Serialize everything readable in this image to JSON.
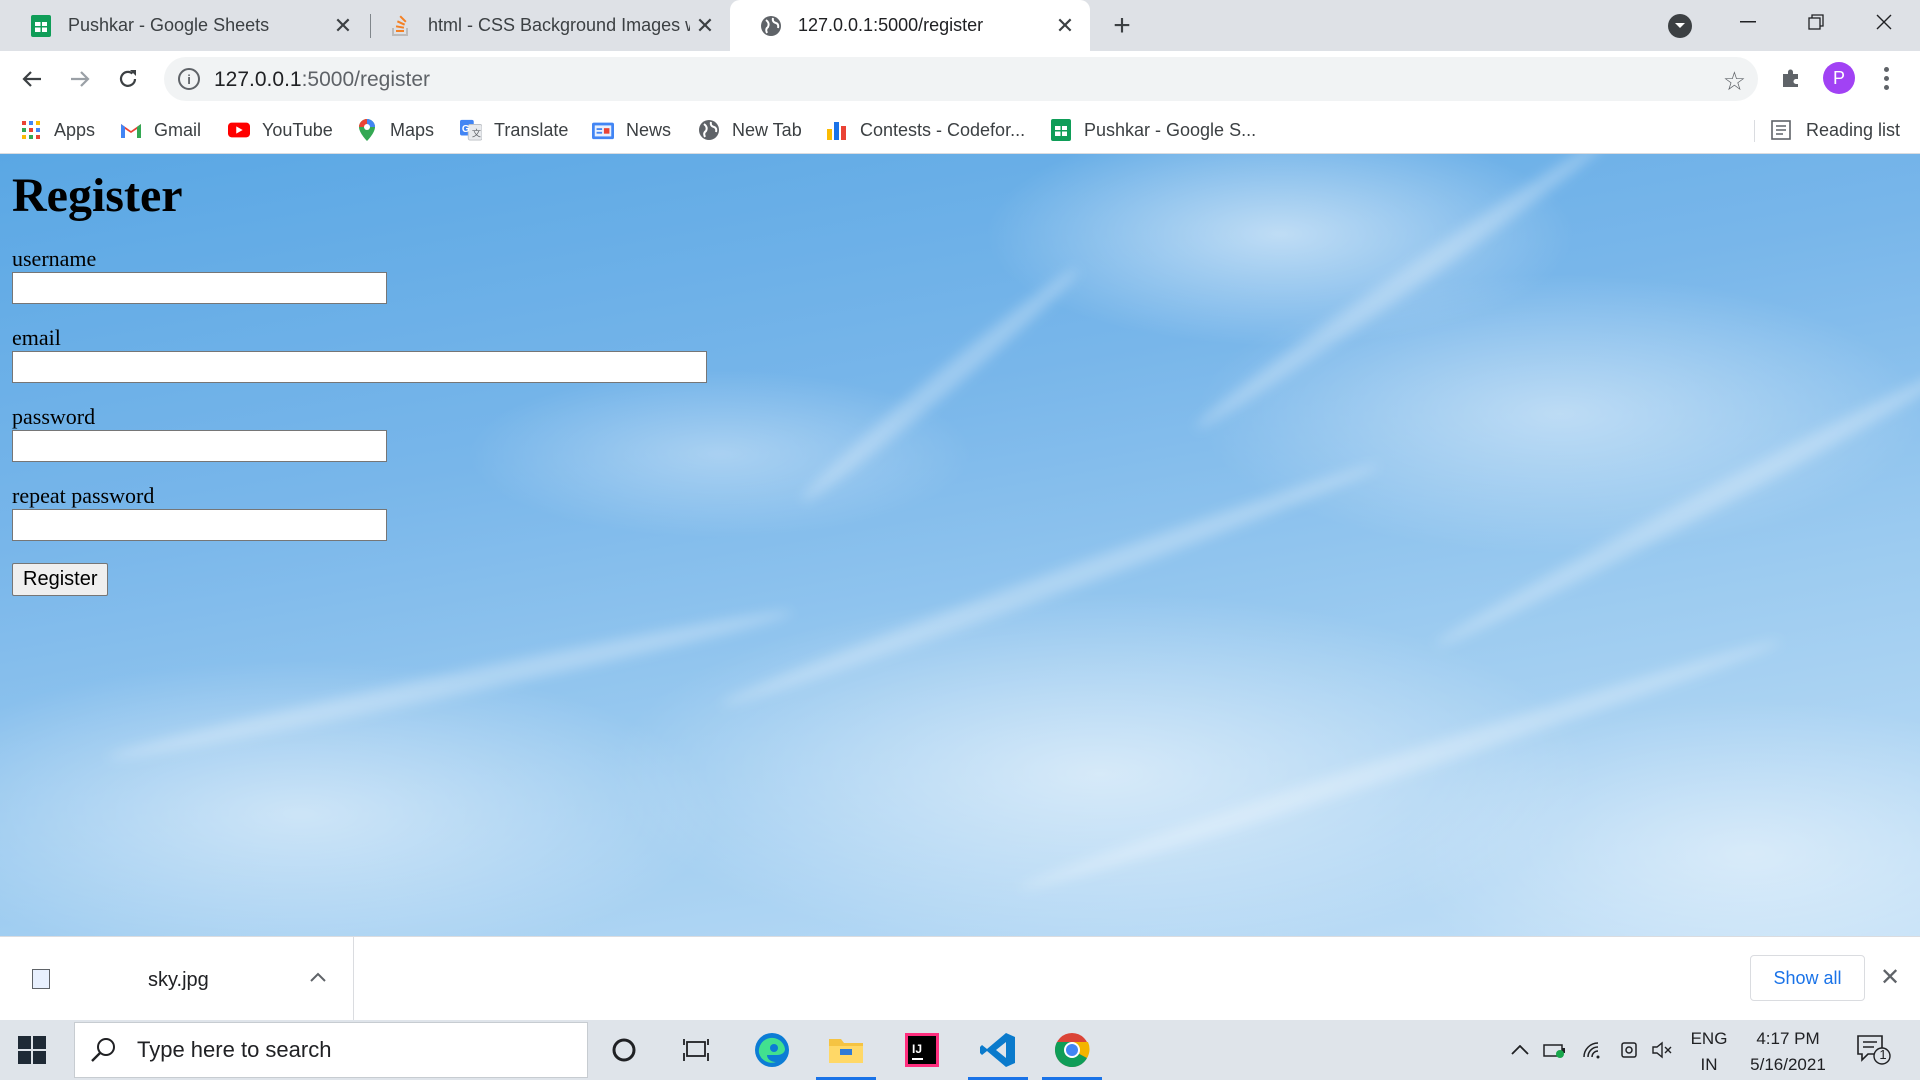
{
  "browser": {
    "tabs": [
      {
        "title": "Pushkar - Google Sheets",
        "icon": "google-sheets-icon",
        "active": false
      },
      {
        "title": "html - CSS Background Images w",
        "icon": "stackoverflow-icon",
        "active": false
      },
      {
        "title": "127.0.0.1:5000/register",
        "icon": "globe-icon",
        "active": true
      }
    ],
    "address": {
      "host": "127.0.0.1",
      "rest": ":5000/register"
    },
    "profile_initial": "P",
    "bookmarks": [
      {
        "label": "Apps",
        "icon": "apps-grid-icon"
      },
      {
        "label": "Gmail",
        "icon": "gmail-icon"
      },
      {
        "label": "YouTube",
        "icon": "youtube-icon"
      },
      {
        "label": "Maps",
        "icon": "maps-pin-icon"
      },
      {
        "label": "Translate",
        "icon": "translate-icon"
      },
      {
        "label": "News",
        "icon": "news-icon"
      },
      {
        "label": "New Tab",
        "icon": "globe-icon"
      },
      {
        "label": "Contests - Codefor...",
        "icon": "codeforces-icon"
      },
      {
        "label": "Pushkar - Google S...",
        "icon": "google-sheets-icon"
      }
    ],
    "reading_list": "Reading list"
  },
  "page": {
    "heading": "Register",
    "fields": [
      {
        "label": "username",
        "value": ""
      },
      {
        "label": "email",
        "value": ""
      },
      {
        "label": "password",
        "value": ""
      },
      {
        "label": "repeat password",
        "value": ""
      }
    ],
    "submit_label": "Register"
  },
  "downloads": {
    "file_name": "sky.jpg",
    "show_all": "Show all"
  },
  "taskbar": {
    "search_placeholder": "Type here to search",
    "language": {
      "line1": "ENG",
      "line2": "IN"
    },
    "time": "4:17 PM",
    "date": "5/16/2021",
    "notification_count": "1"
  },
  "colors": {
    "accent": "#1a73e8",
    "sky_top": "#5aa7e4",
    "sky_bottom": "#c3e0f7",
    "profile": "#a142f4"
  }
}
